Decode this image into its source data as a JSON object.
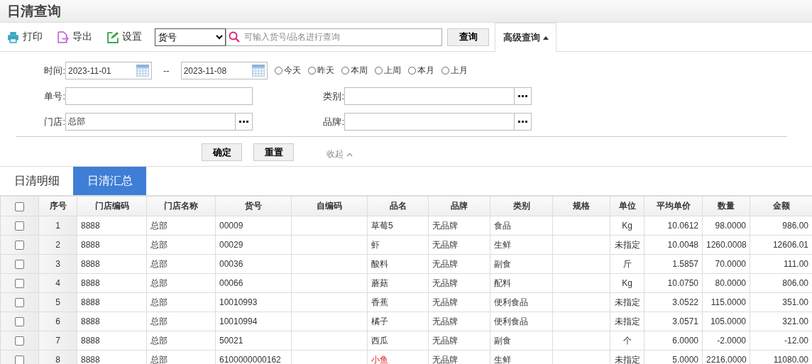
{
  "page_title": "日清查询",
  "toolbar": {
    "actions": [
      {
        "kind": "print",
        "label": "打印"
      },
      {
        "kind": "export",
        "label": "导出"
      },
      {
        "kind": "settings",
        "label": "设置"
      }
    ],
    "field_select": {
      "value": "货号"
    },
    "search": {
      "placeholder": "可输入货号/品名进行查询"
    },
    "query_button": "查询",
    "advanced_toggle": {
      "label": "高级查询",
      "expanded": true
    }
  },
  "filters": {
    "time": {
      "label": "时间:",
      "from": "2023-11-01",
      "separator": "--",
      "to": "2023-11-08"
    },
    "quick_ranges": [
      {
        "label": "今天",
        "selected": false
      },
      {
        "label": "昨天",
        "selected": false
      },
      {
        "label": "本周",
        "selected": false
      },
      {
        "label": "上周",
        "selected": false
      },
      {
        "label": "本月",
        "selected": false
      },
      {
        "label": "上月",
        "selected": false
      }
    ],
    "fields": [
      {
        "label": "单号:",
        "picker": false
      },
      {
        "label": "类别:",
        "picker": true
      },
      {
        "label": "门店:",
        "value": "总部",
        "picker": true
      },
      {
        "label": "品牌:",
        "picker": true
      }
    ],
    "confirm_button": "确定",
    "reset_button": "重置",
    "collapse_link": "收起"
  },
  "tabs": [
    {
      "label": "日清明细",
      "selected": false
    },
    {
      "label": "日清汇总",
      "selected": true
    }
  ],
  "table": {
    "columns": [
      "序号",
      "门店编码",
      "门店名称",
      "货号",
      "自编码",
      "品名",
      "品牌",
      "类别",
      "规格",
      "单位",
      "平均单价",
      "数量",
      "金额"
    ],
    "all_checked": false,
    "rows": [
      {
        "checked": false,
        "flagged": false,
        "cells": [
          "1",
          "8888",
          "总部",
          "00009",
          "",
          "草莓5",
          "无品牌",
          "食品",
          "",
          "Kg",
          "10.0612",
          "98.0000",
          "986.00"
        ]
      },
      {
        "checked": false,
        "flagged": false,
        "cells": [
          "2",
          "8888",
          "总部",
          "00029",
          "",
          "虾",
          "无品牌",
          "生鲜",
          "",
          "未指定",
          "10.0048",
          "1260.0008",
          "12606.01"
        ]
      },
      {
        "checked": false,
        "flagged": false,
        "cells": [
          "3",
          "8888",
          "总部",
          "00036",
          "",
          "酸料",
          "无品牌",
          "副食",
          "",
          "斤",
          "1.5857",
          "70.0000",
          "111.00"
        ]
      },
      {
        "checked": false,
        "flagged": false,
        "cells": [
          "4",
          "8888",
          "总部",
          "00066",
          "",
          "蘑菇",
          "无品牌",
          "配料",
          "",
          "Kg",
          "10.0750",
          "80.0000",
          "806.00"
        ]
      },
      {
        "checked": false,
        "flagged": false,
        "cells": [
          "5",
          "8888",
          "总部",
          "10010993",
          "",
          "香蕉",
          "无品牌",
          "便利食品",
          "",
          "未指定",
          "3.0522",
          "115.0000",
          "351.00"
        ]
      },
      {
        "checked": false,
        "flagged": false,
        "cells": [
          "6",
          "8888",
          "总部",
          "10010994",
          "",
          "橘子",
          "无品牌",
          "便利食品",
          "",
          "未指定",
          "3.0571",
          "105.0000",
          "321.00"
        ]
      },
      {
        "checked": false,
        "flagged": false,
        "cells": [
          "7",
          "8888",
          "总部",
          "50021",
          "",
          "西瓜",
          "无品牌",
          "副食",
          "",
          "个",
          "6.0000",
          "-2.0000",
          "-12.00"
        ]
      },
      {
        "checked": false,
        "flagged": true,
        "cells": [
          "8",
          "8888",
          "总部",
          "6100000000162",
          "",
          "小鱼",
          "无品牌",
          "生鲜",
          "",
          "未指定",
          "5.0000",
          "2216.0000",
          "11080.00"
        ]
      }
    ]
  }
}
